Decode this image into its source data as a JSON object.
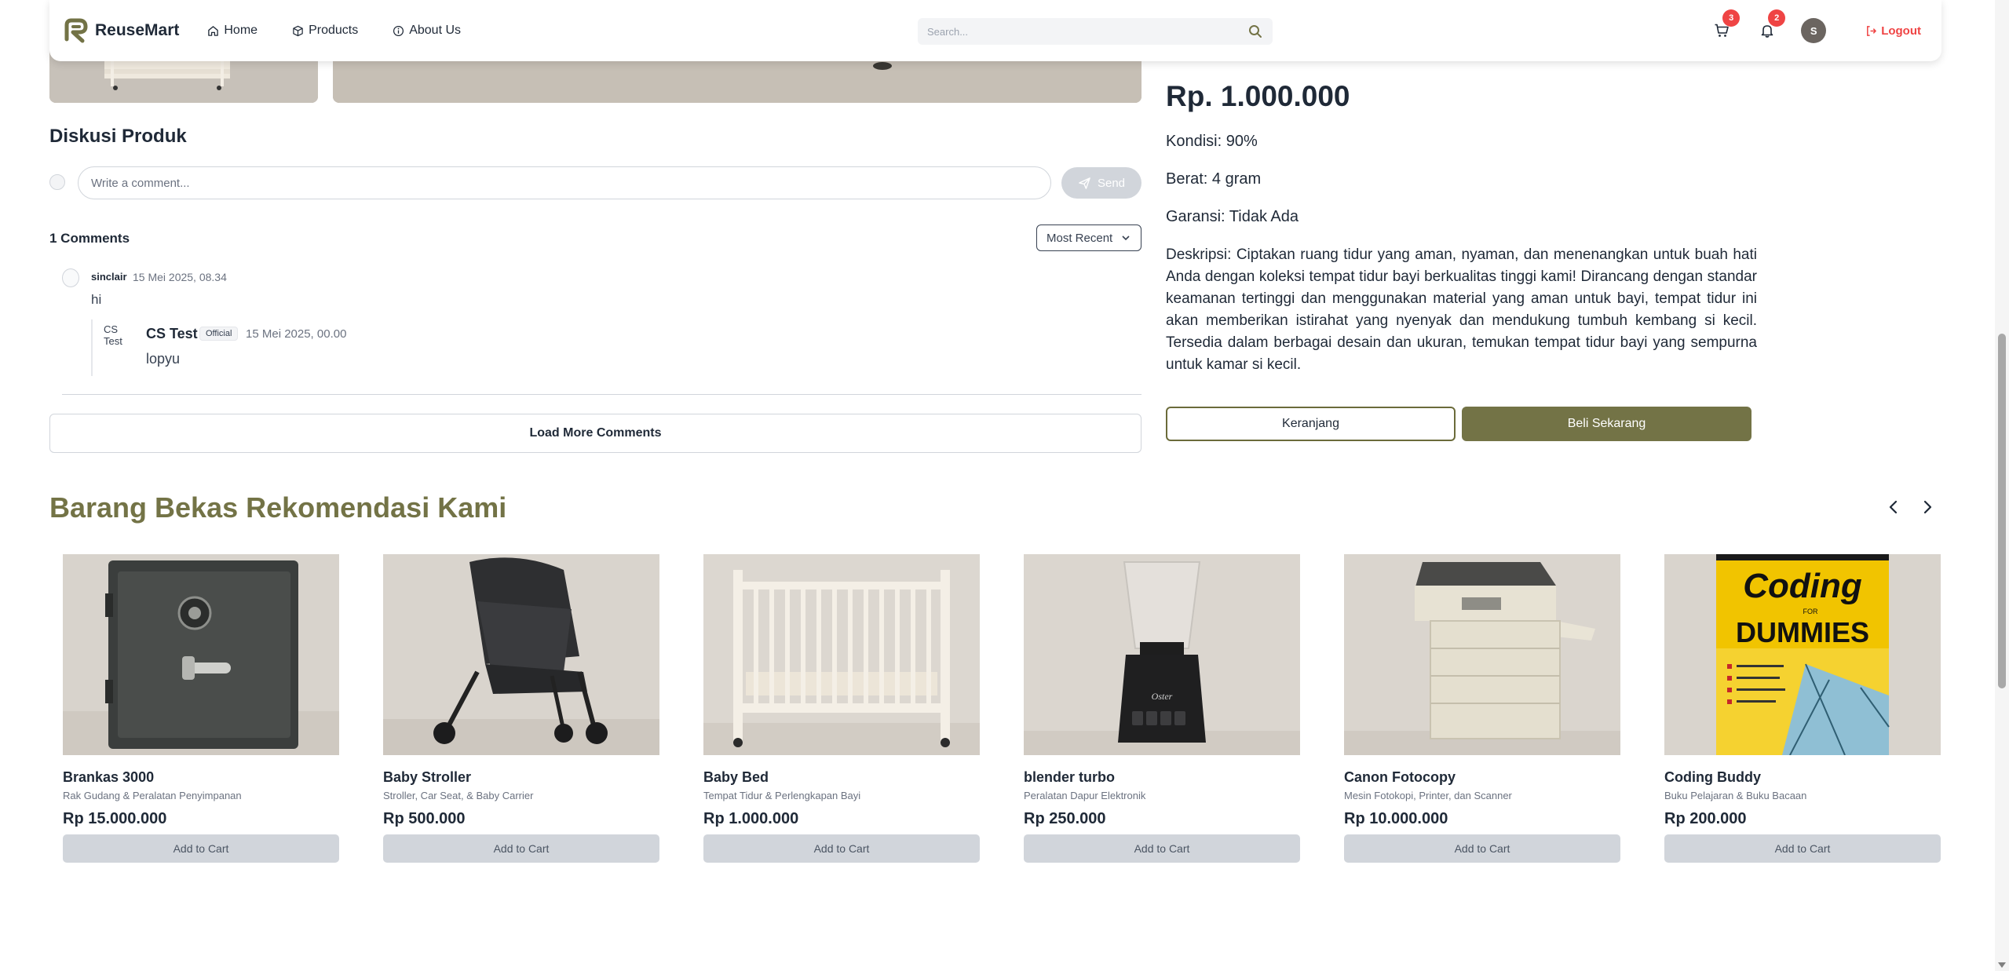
{
  "navbar": {
    "brand": "ReuseMart",
    "links": [
      {
        "label": "Home",
        "icon": "home-icon"
      },
      {
        "label": "Products",
        "icon": "box-icon"
      },
      {
        "label": "About Us",
        "icon": "info-icon"
      }
    ],
    "search_placeholder": "Search...",
    "cart_count": "3",
    "notification_count": "2",
    "avatar_initial": "S",
    "logout_label": "Logout"
  },
  "discussion": {
    "title": "Diskusi Produk",
    "input_placeholder": "Write a comment...",
    "send_label": "Send",
    "count_label": "1 Comments",
    "sort_selected": "Most Recent",
    "comments": [
      {
        "user": "sinclair",
        "time": "15 Mei 2025, 08.34",
        "text": "hi"
      }
    ],
    "replies": [
      {
        "user": "CS Test",
        "badge": "Official",
        "time": "15 Mei 2025, 00.00",
        "text": "lopyu",
        "avatar_alt": "CS Test"
      }
    ],
    "load_more_label": "Load More Comments"
  },
  "product": {
    "price": "Rp. 1.000.000",
    "kondisi": "Kondisi: 90%",
    "berat": "Berat: 4 gram",
    "garansi": "Garansi: Tidak Ada",
    "deskripsi": "Deskripsi: Ciptakan ruang tidur yang aman, nyaman, dan menenangkan untuk buah hati Anda dengan koleksi tempat tidur bayi berkualitas tinggi kami! Dirancang dengan standar keamanan tertinggi dan menggunakan material yang aman untuk bayi, tempat tidur ini akan memberikan istirahat yang nyenyak dan mendukung tumbuh kembang si kecil. Tersedia dalam berbagai desain dan ukuran, temukan tempat tidur bayi yang sempurna untuk kamar si kecil.",
    "cart_button": "Keranjang",
    "buy_button": "Beli Sekarang"
  },
  "recommendations": {
    "title": "Barang Bekas Rekomendasi Kami",
    "add_to_cart_label": "Add to Cart",
    "items": [
      {
        "name": "Brankas 3000",
        "category": "Rak Gudang & Peralatan Penyimpanan",
        "price": "Rp 15.000.000"
      },
      {
        "name": "Baby Stroller",
        "category": "Stroller, Car Seat, & Baby Carrier",
        "price": "Rp 500.000"
      },
      {
        "name": "Baby Bed",
        "category": "Tempat Tidur & Perlengkapan Bayi",
        "price": "Rp 1.000.000"
      },
      {
        "name": "blender turbo",
        "category": "Peralatan Dapur Elektronik",
        "price": "Rp 250.000"
      },
      {
        "name": "Canon Fotocopy",
        "category": "Mesin Fotokopi, Printer, dan Scanner",
        "price": "Rp 10.000.000"
      },
      {
        "name": "Coding Buddy",
        "category": "Buku Pelajaran & Buku Bacaan",
        "price": "Rp 200.000"
      }
    ],
    "book_cover": {
      "title": "Coding",
      "for": "FOR",
      "dummies": "DUMMIES"
    },
    "blender_brand": "Oster"
  },
  "colors": {
    "accent": "#737346",
    "danger": "#ef4444",
    "muted": "#d1d5db"
  }
}
